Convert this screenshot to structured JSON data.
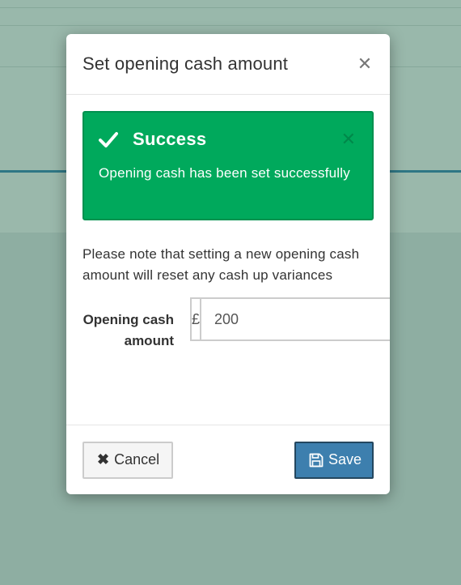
{
  "modal": {
    "title": "Set opening cash amount",
    "close_icon": "close-icon",
    "alert": {
      "icon": "check-icon",
      "title": "Success",
      "message": "Opening cash has been set successfully",
      "dismiss_icon": "close-icon",
      "color": "#00a95c"
    },
    "note": "Please note that setting a new opening cash amount will reset any cash up variances",
    "field": {
      "label": "Opening cash amount",
      "currency_symbol": "£",
      "value": "200"
    },
    "footer": {
      "cancel_label": "Cancel",
      "save_label": "Save",
      "save_color": "#3d7fae"
    }
  }
}
